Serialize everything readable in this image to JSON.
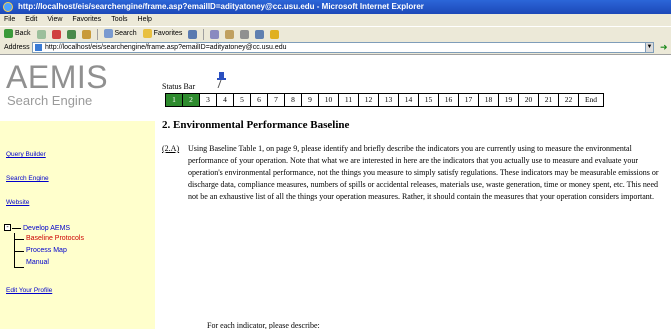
{
  "window": {
    "title": "http://localhost/eis/searchengine/frame.asp?emailID=adityatoney@cc.usu.edu - Microsoft Internet Explorer"
  },
  "menu": [
    "File",
    "Edit",
    "View",
    "Favorites",
    "Tools",
    "Help"
  ],
  "toolbar": {
    "back_label": "Back",
    "search_label": "Search",
    "favorites_label": "Favorites"
  },
  "address": {
    "label": "Address",
    "url": "http://localhost/eis/searchengine/frame.asp?emailID=adityatoney@cc.usu.edu"
  },
  "sidebar": {
    "logo": "AEMIS",
    "logo_sub": "Search Engine",
    "links": [
      "Query Builder",
      "Search Engine",
      "Website"
    ],
    "tree": {
      "root": "Develop AEMS",
      "toggle": "-",
      "children": [
        "Baseline Protocols",
        "Process Map",
        "Manual"
      ]
    },
    "edit_profile": "Edit Your Profile"
  },
  "main": {
    "status_label": "Status Bar",
    "steps": [
      "1",
      "2",
      "3",
      "4",
      "5",
      "6",
      "7",
      "8",
      "9",
      "10",
      "11",
      "12",
      "13",
      "14",
      "15",
      "16",
      "17",
      "18",
      "19",
      "20",
      "21",
      "22",
      "End"
    ],
    "completed_steps": 2,
    "section_title": "2. Environmental Performance Baseline",
    "para_label": "(2.A)",
    "para_text": "Using Baseline Table 1, on page 9, please identify and briefly describe the indicators you are currently using to measure the environmental performance of your operation. Note that what we are interested in here are the indicators that you actually use to measure and evaluate your operation's environmental performance, not the things you measure to simply satisfy regulations. These indicators may be measurable emissions or discharge data, compliance measures, numbers of spills or accidental releases, materials use, waste generation, time or money spent, etc. This need not be an exhaustive list of all the things your operation measures. Rather, it should contain the measures that your operation considers important.",
    "sub_text": "For each indicator, please describe:"
  },
  "colors": {
    "step_done": "#2e8b2e",
    "nav_panel": "#ffffcc",
    "link": "#0000cc",
    "tree_selected": "#cc0000"
  }
}
